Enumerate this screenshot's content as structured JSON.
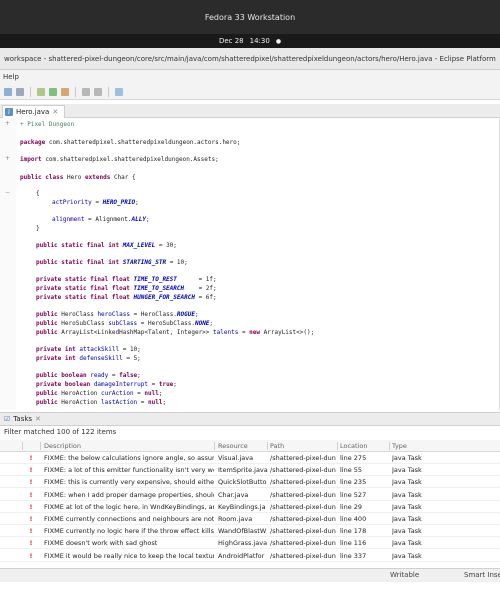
{
  "vm_title": "Fedora 33 Workstation",
  "topbar": {
    "date": "Dec 28",
    "time": "14:30"
  },
  "window_title": "workspace - shattered-pixel-dungeon/core/src/main/java/com/shatteredpixel/shatteredpixeldungeon/actors/hero/Hero.java - Eclipse Platform",
  "menu": {
    "help": "Help"
  },
  "editor": {
    "tab_label": "Hero.java",
    "code": [
      "+ Pixel Dungeon",
      "package com.shatteredpixel.shatteredpixeldungeon.actors.hero;",
      "import com.shatteredpixel.shatteredpixeldungeon.Assets;",
      "public class Hero extends Char {",
      "{",
      "actPriority = HERO_PRIO;",
      "alignment = Alignment.ALLY;",
      "}",
      "public static final int MAX_LEVEL = 30;",
      "public static final int STARTING_STR = 10;",
      "private static final float TIME_TO_REST      = 1f;",
      "private static final float TIME_TO_SEARCH    = 2f;",
      "private static final float HUNGER_FOR_SEARCH = 6f;",
      "public HeroClass heroClass = HeroClass.ROGUE;",
      "public HeroSubClass subClass = HeroSubClass.NONE;",
      "public ArrayList<LinkedHashMap<Talent, Integer>> talents = new ArrayList<>();",
      "private int attackSkill = 10;",
      "private int defenseSkill = 5;",
      "public boolean ready = false;",
      "private boolean damageInterrupt = true;",
      "public HeroAction curAction = null;",
      "public HeroAction lastAction = null;"
    ]
  },
  "tasks": {
    "tab_label": "Tasks",
    "filter_text": "Filter matched 100 of 122 items",
    "columns": [
      "Description",
      "Resource",
      "Path",
      "Location",
      "Type"
    ],
    "rows": [
      {
        "prio": "!",
        "desc": "FIXME: the below calculations ignore angle, so assum",
        "res": "Visual.java",
        "path": "/shattered-pixel-dun",
        "loc": "line 275",
        "type": "Java Task"
      },
      {
        "prio": "!",
        "desc": "FIXME: a lot of this emitter functionality isn't very wel",
        "res": "ItemSprite.java",
        "path": "/shattered-pixel-dun",
        "loc": "line 55",
        "type": "Java Task"
      },
      {
        "prio": "!",
        "desc": "FIXME: this is currently very expensive, should either",
        "res": "QuickSlotButto",
        "path": "/shattered-pixel-dun",
        "loc": "line 235",
        "type": "Java Task"
      },
      {
        "prio": "!",
        "desc": "FIXME: when I add proper damage properties, should",
        "res": "Char.java",
        "path": "/shattered-pixel-dun",
        "loc": "line 527",
        "type": "Java Task"
      },
      {
        "prio": "!",
        "desc": "FIXME at lot of the logic here, in WndKeyBindings, an",
        "res": "KeyBindings.ja",
        "path": "/shattered-pixel-dun",
        "loc": "line 29",
        "type": "Java Task"
      },
      {
        "prio": "!",
        "desc": "FIXME currently connections and neighbours are not j",
        "res": "Room.java",
        "path": "/shattered-pixel-dun",
        "loc": "line 400",
        "type": "Java Task"
      },
      {
        "prio": "!",
        "desc": "FIXME currently no logic here if the throw effect kills",
        "res": "WandOfBlastW",
        "path": "/shattered-pixel-dun",
        "loc": "line 178",
        "type": "Java Task"
      },
      {
        "prio": "!",
        "desc": "FIXME doesn't work with sad ghost",
        "res": "HighGrass.java",
        "path": "/shattered-pixel-dun",
        "loc": "line 116",
        "type": "Java Task"
      },
      {
        "prio": "!",
        "desc": "FIXME it would be really nice to keep the local texture",
        "res": "AndroidPlatfor",
        "path": "/shattered-pixel-dun",
        "loc": "line 337",
        "type": "Java Task"
      }
    ]
  },
  "status": {
    "writable": "Writable",
    "insert": "Smart Insert"
  },
  "colors": {
    "keyword": "#7f0055",
    "comment": "#3f7f5f",
    "field": "#0000c0",
    "priority": "#d32f2f"
  }
}
